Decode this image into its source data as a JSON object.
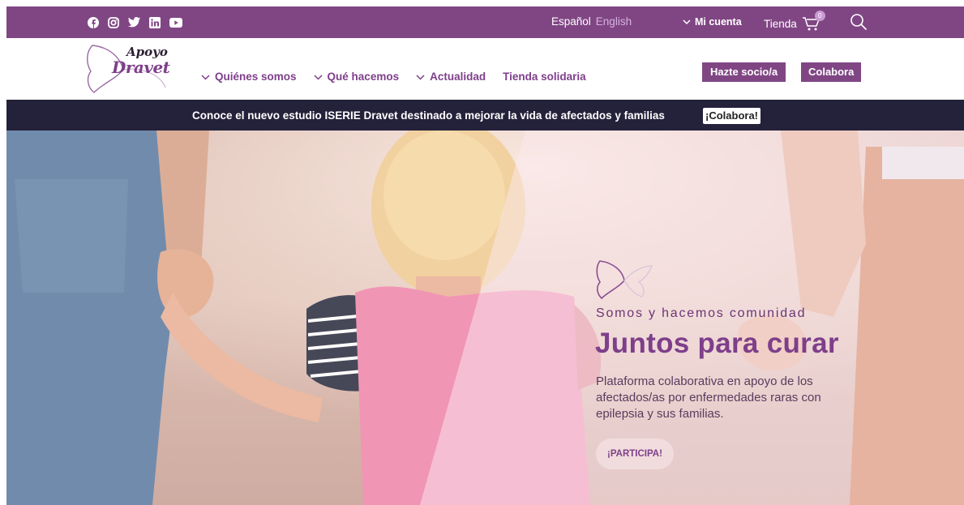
{
  "topbar": {
    "social": [
      "facebook-icon",
      "instagram-icon",
      "twitter-icon",
      "linkedin-icon",
      "youtube-icon"
    ],
    "lang_es": "Español",
    "lang_en": "English",
    "account": "Mi cuenta",
    "shop": "Tienda",
    "cart_count": "0"
  },
  "nav": {
    "logo_top": "Apoyo",
    "logo_bottom": "Dravet",
    "items": [
      {
        "label": "Quiénes somos",
        "dropdown": true
      },
      {
        "label": "Qué hacemos",
        "dropdown": true
      },
      {
        "label": "Actualidad",
        "dropdown": true
      },
      {
        "label": "Tienda solidaria",
        "dropdown": false
      }
    ],
    "btn_socio": "Hazte socio/a",
    "btn_colabora": "Colabora"
  },
  "announcement": {
    "text": "Conoce el nuevo estudio ISERIE Dravet destinado a mejorar la vida de afectados y familias",
    "button": "¡Colabora!"
  },
  "hero": {
    "subtitle": "Somos y hacemos comunidad",
    "title": "Juntos para curar",
    "description": "Plataforma colaborativa en apoyo de los afectados/as por enfermedades raras con epilepsia y sus familias.",
    "cta": "¡PARTICIPA!"
  },
  "colors": {
    "brand_purple": "#804684",
    "announce_bg": "#24213a",
    "heading_purple": "#7e3f8a"
  }
}
